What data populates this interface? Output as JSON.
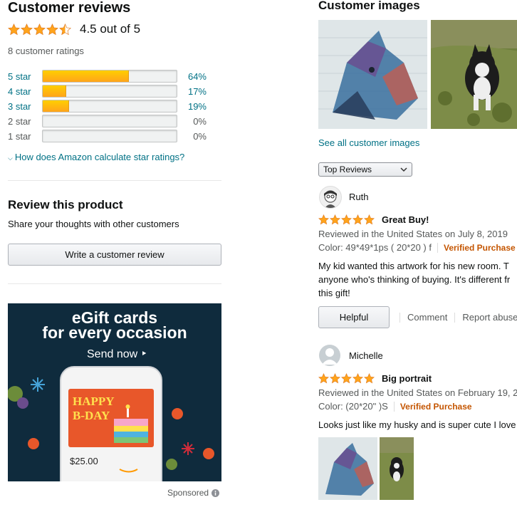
{
  "summary": {
    "title": "Customer reviews",
    "rating_text": "4.5 out of 5",
    "rating_value": 4.5,
    "total_ratings": "8 customer ratings",
    "histogram": [
      {
        "label": "5 star",
        "percent_text": "64%",
        "percent": 64,
        "linked": true
      },
      {
        "label": "4 star",
        "percent_text": "17%",
        "percent": 17,
        "linked": true
      },
      {
        "label": "3 star",
        "percent_text": "19%",
        "percent": 19,
        "linked": true
      },
      {
        "label": "2 star",
        "percent_text": "0%",
        "percent": 0,
        "linked": false
      },
      {
        "label": "1 star",
        "percent_text": "0%",
        "percent": 0,
        "linked": false
      }
    ],
    "how_calculated": "How does Amazon calculate star ratings?"
  },
  "review_product": {
    "title": "Review this product",
    "subtitle": "Share your thoughts with other customers",
    "button": "Write a customer review"
  },
  "ad": {
    "headline_1": "eGift cards",
    "headline_2": "for every occasion",
    "cta": "Send now ‣",
    "card_line_1": "HAPPY",
    "card_line_2": "B-DAY",
    "card_amount": "$25.00",
    "sponsored": "Sponsored"
  },
  "customer_images": {
    "title": "Customer images",
    "see_all": "See all customer images"
  },
  "sort": {
    "selected": "Top Reviews"
  },
  "reviews": [
    {
      "name": "Ruth",
      "stars": 5,
      "title": "Great Buy!",
      "reviewed": "Reviewed in the United States on July 8, 2019",
      "color": "Color: 49*49*1ps ( 20*20 ) f",
      "verified": "Verified Purchase",
      "body_1": "My kid wanted this artwork for his new room. T",
      "body_2": "anyone who's thinking of buying. It's different fr",
      "body_3": "this gift!",
      "helpful": "Helpful",
      "comment": "Comment",
      "report": "Report abuse"
    },
    {
      "name": "Michelle",
      "stars": 5,
      "title": "Big portrait",
      "reviewed": "Reviewed in the United States on February 19, 2",
      "color": "Color: (20*20\" )S",
      "verified": "Verified Purchase",
      "body_1": "Looks just like my husky and is super cute I love"
    }
  ],
  "colors": {
    "link": "#007185",
    "star": "#ffa41c",
    "verified": "#c45500",
    "ad_bg": "#0f2b3d"
  }
}
